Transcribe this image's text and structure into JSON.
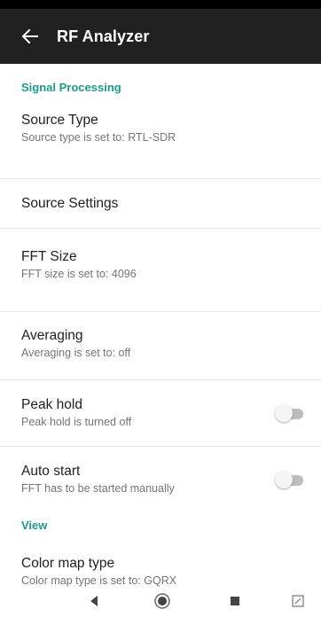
{
  "app": {
    "title": "RF Analyzer"
  },
  "sections": {
    "signal": "Signal Processing",
    "view": "View"
  },
  "prefs": {
    "source_type": {
      "title": "Source Type",
      "summary": "Source type is set to: RTL-SDR"
    },
    "source_settings": {
      "title": "Source Settings"
    },
    "fft_size": {
      "title": "FFT Size",
      "summary": "FFT size is set to: 4096"
    },
    "averaging": {
      "title": "Averaging",
      "summary": "Averaging is set to: off"
    },
    "peak_hold": {
      "title": "Peak hold",
      "summary": "Peak hold is turned off",
      "enabled": false
    },
    "auto_start": {
      "title": "Auto start",
      "summary": "FFT has to be started manually",
      "enabled": false
    },
    "color_map": {
      "title": "Color map type",
      "summary": "Color map type is set to: GQRX"
    }
  },
  "icons": {
    "back": "arrow-back-icon",
    "nav_back": "triangle-back-icon",
    "nav_home": "circle-home-icon",
    "nav_recents": "square-recents-icon",
    "nav_extra": "rotate-screen-icon"
  },
  "colors": {
    "appbar": "#212121",
    "accent": "#1e9a8c"
  }
}
